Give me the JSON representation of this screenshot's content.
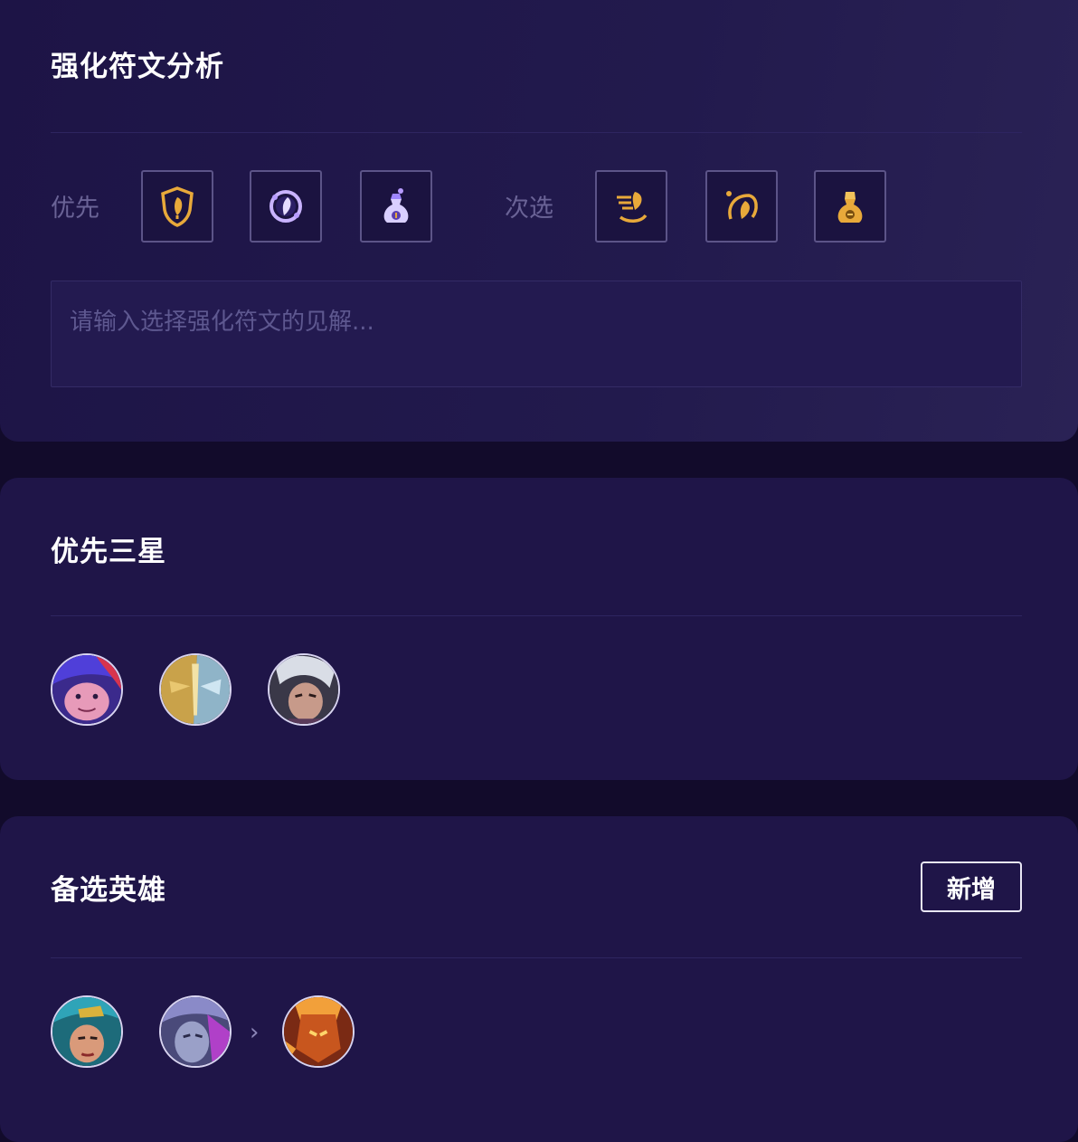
{
  "augments": {
    "title": "强化符文分析",
    "priority_label": "优先",
    "secondary_label": "次选",
    "priority_runes": [
      "shield-rune-icon",
      "orb-rune-icon",
      "potion-bag-rune-icon"
    ],
    "secondary_runes": [
      "swirl-rune-icon",
      "horn-rune-icon",
      "gold-bag-rune-icon"
    ],
    "note_placeholder": "请输入选择强化符文的见解..."
  },
  "three_star": {
    "title": "优先三星",
    "champions": [
      "champion-portrait-1",
      "champion-portrait-2",
      "champion-portrait-3"
    ]
  },
  "backup": {
    "title": "备选英雄",
    "add_label": "新增",
    "separator": "›",
    "champions": [
      "champion-portrait-4",
      "champion-portrait-5",
      "champion-portrait-6"
    ]
  },
  "colors": {
    "background": "#120b2b",
    "card": "#1f1548",
    "gold": "#e8a93a",
    "purple": "#b79bff"
  }
}
